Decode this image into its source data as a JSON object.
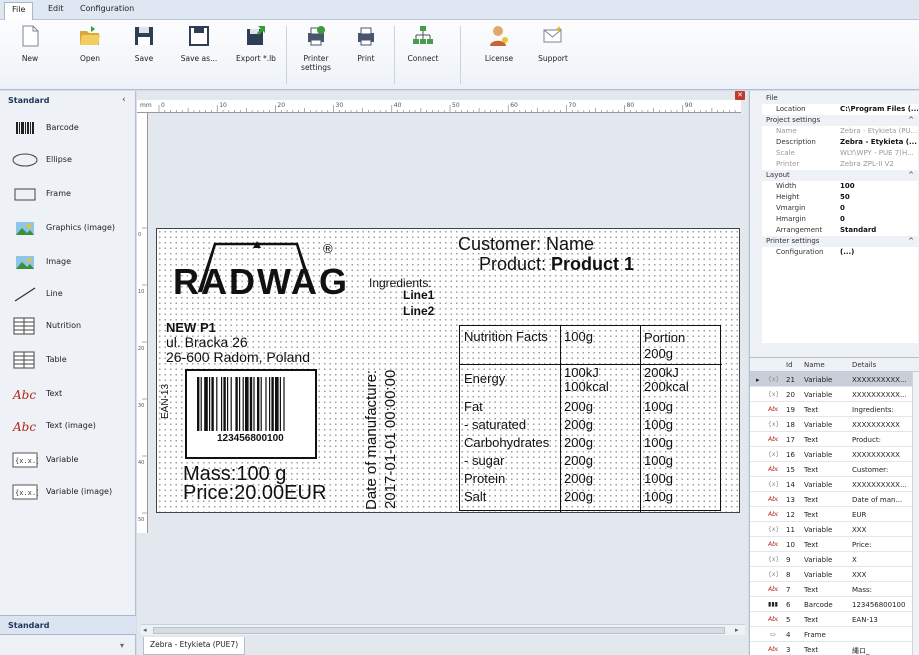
{
  "menu": {
    "items": [
      "File",
      "Edit",
      "Configuration"
    ]
  },
  "ribbon": {
    "buttons": [
      {
        "label": "New",
        "icon": "new-document-icon"
      },
      {
        "label": "Open",
        "icon": "folder-open-icon"
      },
      {
        "label": "Save",
        "icon": "floppy-disk-icon"
      },
      {
        "label": "Save as...",
        "icon": "save-as-icon"
      },
      {
        "label": "Export *.lb",
        "icon": "export-icon"
      },
      {
        "label": "Printer\nsettings",
        "icon": "printer-settings-icon"
      },
      {
        "label": "Print",
        "icon": "printer-icon"
      },
      {
        "label": "Connect",
        "icon": "network-icon"
      },
      {
        "label": "License",
        "icon": "license-user-icon"
      },
      {
        "label": "Support",
        "icon": "envelope-icon"
      }
    ]
  },
  "left_panel": {
    "title": "Standard",
    "tools": [
      {
        "label": "Barcode",
        "icon": "barcode-icon"
      },
      {
        "label": "Ellipse",
        "icon": "ellipse-icon"
      },
      {
        "label": "Frame",
        "icon": "frame-icon"
      },
      {
        "label": "Graphics (image)",
        "icon": "graphics-image-icon"
      },
      {
        "label": "Image",
        "icon": "image-icon"
      },
      {
        "label": "Line",
        "icon": "line-icon"
      },
      {
        "label": "Nutrition",
        "icon": "nutrition-icon"
      },
      {
        "label": "Table",
        "icon": "table-icon"
      },
      {
        "label": "Text",
        "icon": "text-icon"
      },
      {
        "label": "Text (image)",
        "icon": "text-image-icon"
      },
      {
        "label": "Variable",
        "icon": "variable-icon"
      },
      {
        "label": "Variable (image)",
        "icon": "variable-image-icon"
      }
    ],
    "bottom_title": "Standard"
  },
  "ruler": {
    "unit": "mm",
    "ticks": [
      "0",
      "10",
      "20",
      "30",
      "40",
      "50",
      "60",
      "70",
      "80",
      "90",
      "10"
    ],
    "left_ticks": [
      "0",
      "10",
      "20",
      "30",
      "40",
      "50"
    ]
  },
  "label": {
    "logo_text": "RADWAG",
    "registered_mark": "®",
    "company": "NEW P1",
    "street": "ul. Bracka 26",
    "city": "26-600 Radom, Poland",
    "barcode_type": "EAN-13",
    "barcode_number": "123456800100",
    "mass": "Mass:100 g",
    "price": "Price:20.00EUR",
    "date_label": "Date of manufacture:",
    "date_value": "2017-01-01 00:00:00",
    "ingredients_label": "Ingredients:",
    "ingredients_lines": [
      "Line1",
      "Line2"
    ],
    "customer": "Customer: Name",
    "product_label": "Product: ",
    "product_value": "Product 1",
    "nutrition": {
      "header": [
        "Nutrition Facts",
        "100g",
        "Portion\n200g"
      ],
      "rows": [
        [
          "Energy",
          "100kJ\n100kcal",
          "200kJ\n200kcal"
        ],
        [
          "Fat",
          "200g",
          "100g"
        ],
        [
          "- saturated",
          "200g",
          "100g"
        ],
        [
          "Carbohydrates",
          "200g",
          "100g"
        ],
        [
          "- sugar",
          "200g",
          "100g"
        ],
        [
          "Protein",
          "200g",
          "100g"
        ],
        [
          "Salt",
          "200g",
          "100g"
        ]
      ]
    }
  },
  "document_tab": "Zebra - Etykieta (PUE7)",
  "properties": {
    "sections": [
      {
        "title": "File",
        "rows": [
          {
            "key": "Location",
            "value": "C:\\Program Files (...",
            "bold": true
          }
        ]
      },
      {
        "title": "Project settings",
        "rows": [
          {
            "key": "Name",
            "value": "Zebra - Etykieta (PU...",
            "dim": true
          },
          {
            "key": "Description",
            "value": "Zebra - Etykieta (...",
            "bold": true
          },
          {
            "key": "Scale",
            "value": "WLY\\WPY - PUE 7(H...",
            "dim": true
          },
          {
            "key": "Printer",
            "value": "Zebra ZPL-II V2",
            "dim": true
          }
        ]
      },
      {
        "title": "Layout",
        "rows": [
          {
            "key": "Width",
            "value": "100",
            "bold": true
          },
          {
            "key": "Height",
            "value": "50",
            "bold": true
          },
          {
            "key": "Vmargin",
            "value": "0",
            "bold": true
          },
          {
            "key": "Hmargin",
            "value": "0",
            "bold": true
          },
          {
            "key": "Arrangement",
            "value": "Standard",
            "bold": true
          }
        ]
      },
      {
        "title": "Printer settings",
        "rows": [
          {
            "key": "Configuration",
            "value": "(...)",
            "bold": true
          }
        ]
      }
    ]
  },
  "objects_grid": {
    "headers": [
      "Id",
      "Name",
      "Details"
    ],
    "rows": [
      {
        "id": "21",
        "name": "Variable",
        "details": "XXXXXXXXXX...",
        "selected": true
      },
      {
        "id": "20",
        "name": "Variable",
        "details": "XXXXXXXXXX..."
      },
      {
        "id": "19",
        "name": "Text",
        "details": "Ingredients:"
      },
      {
        "id": "18",
        "name": "Variable",
        "details": "XXXXXXXXXX"
      },
      {
        "id": "17",
        "name": "Text",
        "details": "Product:"
      },
      {
        "id": "16",
        "name": "Variable",
        "details": "XXXXXXXXXX"
      },
      {
        "id": "15",
        "name": "Text",
        "details": "Customer:"
      },
      {
        "id": "14",
        "name": "Variable",
        "details": "XXXXXXXXXX..."
      },
      {
        "id": "13",
        "name": "Text",
        "details": "Date of man..."
      },
      {
        "id": "12",
        "name": "Text",
        "details": "EUR"
      },
      {
        "id": "11",
        "name": "Variable",
        "details": "XXX"
      },
      {
        "id": "10",
        "name": "Text",
        "details": "Price:"
      },
      {
        "id": "9",
        "name": "Variable",
        "details": "X"
      },
      {
        "id": "8",
        "name": "Variable",
        "details": "XXX"
      },
      {
        "id": "7",
        "name": "Text",
        "details": "Mass:"
      },
      {
        "id": "6",
        "name": "Barcode",
        "details": "123456800100"
      },
      {
        "id": "5",
        "name": "Text",
        "details": "EAN-13"
      },
      {
        "id": "4",
        "name": "Frame",
        "details": ""
      },
      {
        "id": "3",
        "name": "Text",
        "details": "縄ロ_"
      }
    ]
  },
  "colors": {
    "accent": "#1d3557",
    "selection": "#c9cfd8",
    "close": "#c0392b"
  }
}
